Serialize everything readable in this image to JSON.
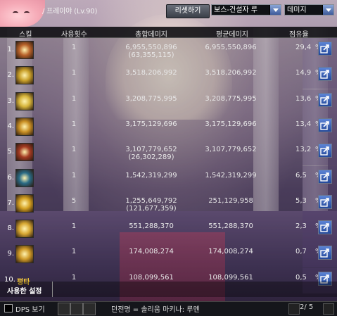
{
  "header": {
    "player": "/ 프레이야 (Lv.90)",
    "reset_label": "리셋하기",
    "boss_select": "보스-건설자 루",
    "metric_select": "데미지"
  },
  "columns": [
    "스킬",
    "사용횟수",
    "총합데미지",
    "평균데미지",
    "점유율"
  ],
  "rows": [
    {
      "rank": "1.",
      "count": "1",
      "total": "6,955,550,896",
      "total_sub": "(63,355,115)",
      "avg": "6,955,550,896",
      "pct": "29,4",
      "pct_unit": "%",
      "icon": "skill-icon-1",
      "color": "#b8622a"
    },
    {
      "rank": "2.",
      "count": "1",
      "total": "3,518,206,992",
      "total_sub": "",
      "avg": "3,518,206,992",
      "pct": "14,9",
      "pct_unit": "%",
      "icon": "skill-icon-2",
      "color": "#c9a02a"
    },
    {
      "rank": "3.",
      "count": "1",
      "total": "3,208,775,995",
      "total_sub": "",
      "avg": "3,208,775,995",
      "pct": "13,6",
      "pct_unit": "%",
      "icon": "skill-icon-3",
      "color": "#d6b43a"
    },
    {
      "rank": "4.",
      "count": "1",
      "total": "3,175,129,696",
      "total_sub": "",
      "avg": "3,175,129,696",
      "pct": "13,4",
      "pct_unit": "%",
      "icon": "skill-icon-4",
      "color": "#c98f24"
    },
    {
      "rank": "5.",
      "count": "1",
      "total": "3,107,779,652",
      "total_sub": "(26,302,289)",
      "avg": "3,107,779,652",
      "pct": "13,2",
      "pct_unit": "%",
      "icon": "skill-icon-5",
      "color": "#a33a22"
    },
    {
      "rank": "6.",
      "count": "1",
      "total": "1,542,319,299",
      "total_sub": "",
      "avg": "1,542,319,299",
      "pct": "6,5",
      "pct_unit": "%",
      "icon": "skill-icon-6",
      "color": "#2a6b86"
    },
    {
      "rank": "7.",
      "count": "5",
      "total": "1,255,649,792",
      "total_sub": "(121,677,359)",
      "avg": "251,129,958",
      "pct": "5,3",
      "pct_unit": "%",
      "icon": "skill-icon-7",
      "color": "#d4a020"
    },
    {
      "rank": "8.",
      "count": "1",
      "total": "551,288,370",
      "total_sub": "",
      "avg": "551,288,370",
      "pct": "2,3",
      "pct_unit": "%",
      "icon": "skill-icon-8",
      "color": "#d8a832"
    },
    {
      "rank": "9.",
      "count": "1",
      "total": "174,008,274",
      "total_sub": "",
      "avg": "174,008,274",
      "pct": "0,7",
      "pct_unit": "%",
      "icon": "skill-icon-9",
      "color": "#cf9a28"
    },
    {
      "rank": "10.",
      "count": "1",
      "total": "108,099,561",
      "total_sub": "",
      "avg": "108,099,561",
      "pct": "0,5",
      "pct_unit": "%",
      "icon": "",
      "color": "",
      "skill_name": "평타"
    }
  ],
  "used_settings": "사용한 설정",
  "footer": {
    "dps_label": "DPS 보기",
    "dungeon": "던전명 = 솔리움 마키나: 루멘",
    "page": "2/ 5"
  },
  "colors": {
    "share_btn": "#2f5fb8",
    "accent": "#ffd23a"
  }
}
